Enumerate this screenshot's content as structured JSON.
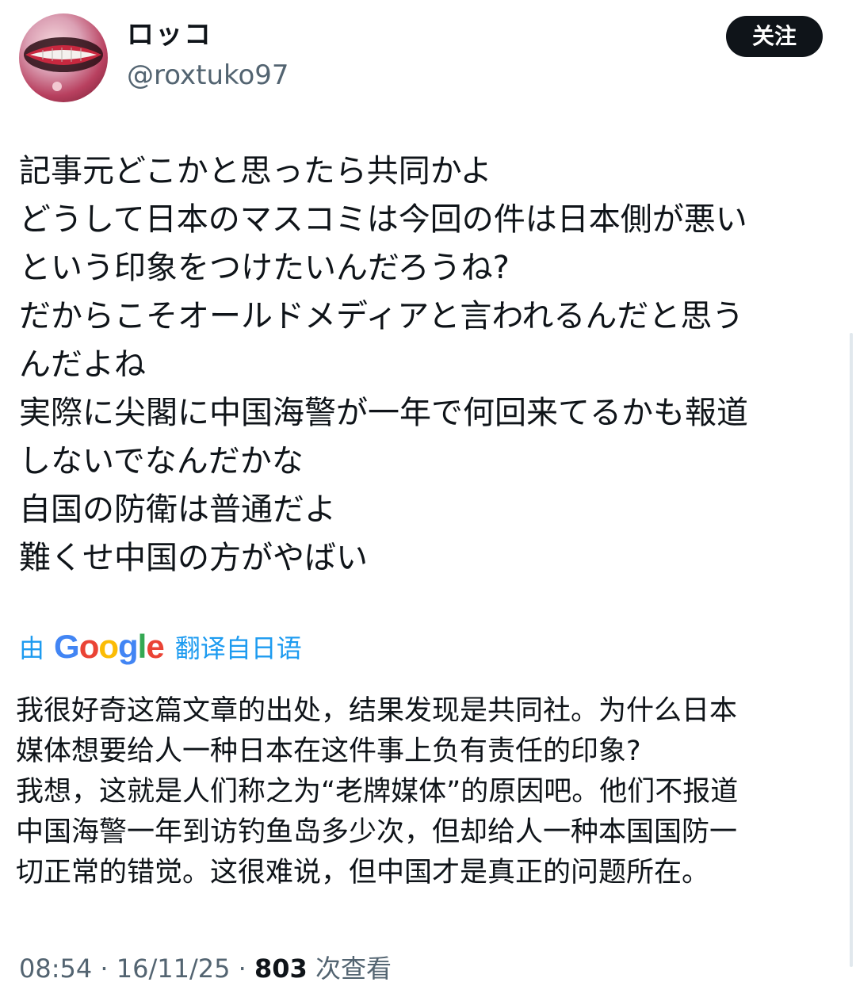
{
  "user": {
    "display_name": "ロッコ",
    "handle": "@roxtuko97",
    "follow_label": "关注"
  },
  "tweet": {
    "lines": [
      "記事元どこかと思ったら共同かよ",
      "どうして日本のマスコミは今回の件は日本側が悪い",
      "という印象をつけたいんだろうね?",
      "だからこそオールドメディアと言われるんだと思う",
      "んだよね",
      "実際に尖閣に中国海警が一年で何回来てるかも報道",
      "しないでなんだかな",
      "自国の防衛は普通だよ",
      "難くせ中国の方がやばい"
    ]
  },
  "translation": {
    "prefix": "由",
    "provider": "Google",
    "suffix": "翻译自日语",
    "lines": [
      "我很好奇这篇文章的出处，结果发现是共同社。为什么日本",
      "媒体想要给人一种日本在这件事上负有责任的印象?",
      "我想，这就是人们称之为“老牌媒体”的原因吧。他们不报道",
      "中国海警一年到访钓鱼岛多少次，但却给人一种本国国防一",
      "切正常的错觉。这很难说，但中国才是真正的问题所在。"
    ]
  },
  "meta": {
    "time": "08:54",
    "separator": "·",
    "date": "16/11/25",
    "views_count": "803",
    "views_label": "次查看"
  },
  "colors": {
    "accent": "#1d9bf0",
    "text": "#0f1419",
    "muted": "#536471",
    "button_bg": "#0f1419",
    "google_blue": "#4285F4",
    "google_red": "#EA4335",
    "google_yellow": "#FBBC05",
    "google_green": "#34A853"
  }
}
